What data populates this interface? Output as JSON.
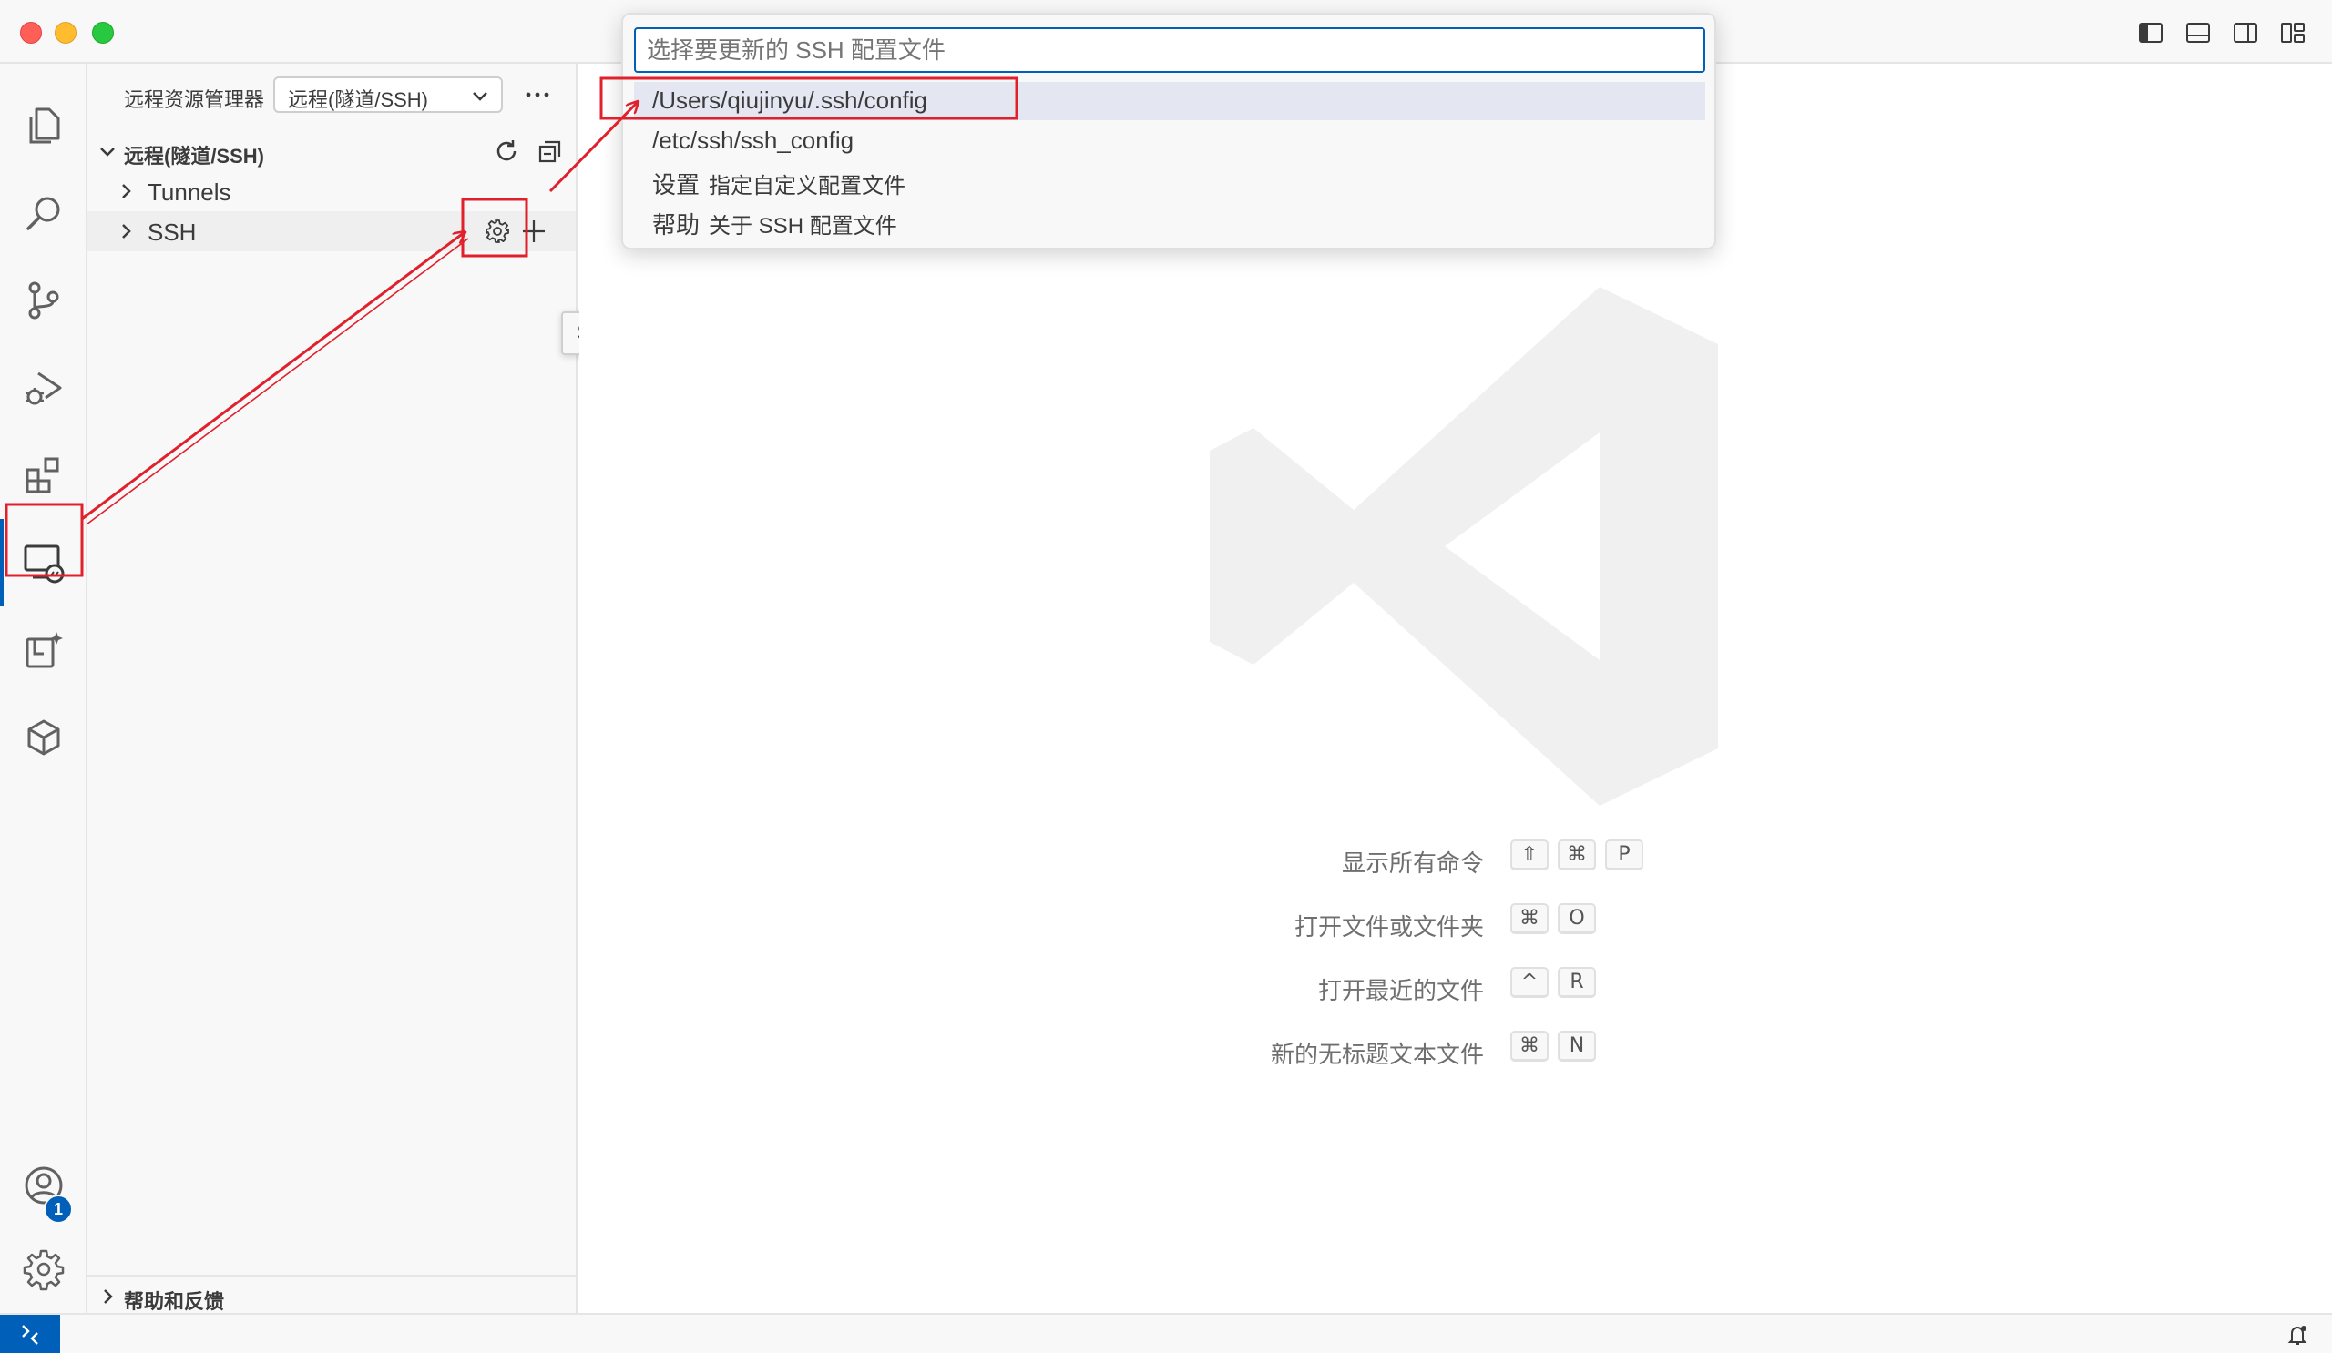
{
  "colors": {
    "accent": "#005fb8",
    "annotation": "#e0212c"
  },
  "activity_bar": {
    "items": [
      "files-icon",
      "search-icon",
      "source-control-icon",
      "run-debug-icon",
      "extensions-icon",
      "remote-explorer-icon",
      "ai-chat-icon",
      "containers-icon"
    ],
    "accounts_badge": "1"
  },
  "sidebar": {
    "title": "远程资源管理器",
    "selector_value": "远程(隧道/SSH)",
    "section_title": "远程(隧道/SSH)",
    "items": [
      {
        "label": "Tunnels"
      },
      {
        "label": "SSH"
      }
    ],
    "tooltip": "SSH",
    "help_section": "帮助和反馈"
  },
  "quick_pick": {
    "placeholder": "选择要更新的 SSH 配置文件",
    "items": [
      {
        "label": "/Users/qiujinyu/.ssh/config",
        "description": ""
      },
      {
        "label": "/etc/ssh/ssh_config",
        "description": ""
      },
      {
        "label": "设置",
        "description": "指定自定义配置文件"
      },
      {
        "label": "帮助",
        "description": "关于 SSH 配置文件"
      }
    ]
  },
  "welcome": {
    "shortcuts": [
      {
        "label": "显示所有命令",
        "keys": [
          "⇧",
          "⌘",
          "P"
        ]
      },
      {
        "label": "打开文件或文件夹",
        "keys": [
          "⌘",
          "O"
        ]
      },
      {
        "label": "打开最近的文件",
        "keys": [
          "^",
          "R"
        ]
      },
      {
        "label": "新的无标题文本文件",
        "keys": [
          "⌘",
          "N"
        ]
      }
    ]
  }
}
